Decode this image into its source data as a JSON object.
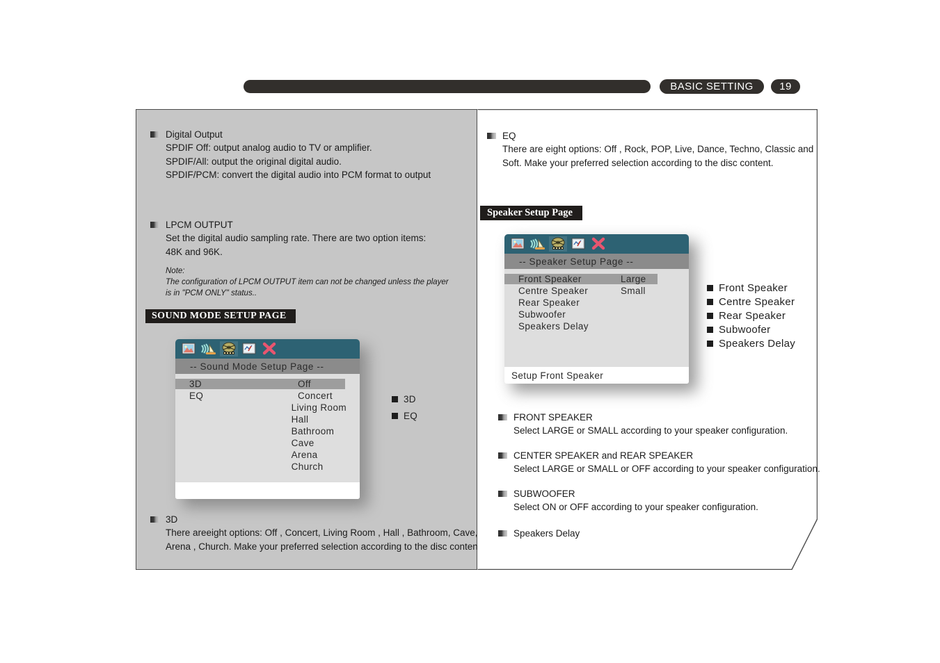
{
  "header": {
    "section_label": "BASIC SETTING",
    "page_number": "19"
  },
  "left_column": {
    "digital_output": {
      "heading": "Digital Output",
      "lines": [
        "SPDIF Off: output analog audio to TV or amplifier.",
        "SPDIF/All: output the original digital audio.",
        "SPDIF/PCM: convert the digital audio into PCM format to output"
      ]
    },
    "lpcm_output": {
      "heading": "LPCM OUTPUT",
      "lines": [
        "Set the digital audio sampling rate. There are two option items:",
        "48K and 96K."
      ],
      "note_label": "Note:",
      "note_lines": [
        "The configuration of LPCM OUTPUT item can not be changed unless the player",
        "is in \"PCM ONLY\" status.."
      ]
    },
    "sound_mode_chip": "SOUND MODE SETUP PAGE",
    "sound_osd": {
      "title": "-- Sound Mode Setup Page --",
      "icons": [
        "picture-icon",
        "speaker-icon",
        "film-reel-icon",
        "preferences-icon",
        "close-x-icon"
      ],
      "selected_icon_index": 2,
      "items": [
        "3D",
        "EQ"
      ],
      "highlighted_item": "3D",
      "options": [
        "Off",
        "Concert",
        "Living Room",
        "Hall",
        "Bathroom",
        "Cave",
        "Arena",
        "Church"
      ],
      "highlighted_option": "Off",
      "footer": ""
    },
    "sound_callout": [
      "3D",
      "EQ"
    ],
    "threed": {
      "heading": "3D",
      "lines": [
        "There areeight options: Off , Concert, Living Room ,  Hall , Bathroom, Cave,",
        "Arena , Church. Make your preferred selection according to the disc content."
      ]
    }
  },
  "right_column": {
    "eq": {
      "heading": "EQ",
      "lines": [
        "There are eight options: Off , Rock, POP, Live, Dance, Techno, Classic and",
        "Soft. Make your preferred selection according to the disc content."
      ]
    },
    "speaker_chip": "Speaker Setup Page",
    "speaker_osd": {
      "title": "-- Speaker Setup Page --",
      "icons": [
        "picture-icon",
        "speaker-icon",
        "film-reel-icon",
        "preferences-icon",
        "close-x-icon"
      ],
      "selected_icon_index": 2,
      "items": [
        "Front Speaker",
        "Centre Speaker",
        "Rear Speaker",
        "Subwoofer",
        "Speakers Delay"
      ],
      "highlighted_item": "Front Speaker",
      "options": [
        "Large",
        "Small"
      ],
      "highlighted_option": "Large",
      "footer": "Setup Front Speaker"
    },
    "speaker_callout": [
      "Front Speaker",
      "Centre Speaker",
      "Rear Speaker",
      "Subwoofer",
      "Speakers Delay"
    ],
    "front_speaker": {
      "heading": "FRONT SPEAKER",
      "lines": [
        "Select LARGE or SMALL according to your speaker configuration."
      ]
    },
    "center_rear_speaker": {
      "heading": "CENTER SPEAKER and REAR SPEAKER",
      "lines": [
        "Select LARGE or SMALL or OFF according to your speaker configuration."
      ]
    },
    "subwoofer": {
      "heading": "SUBWOOFER",
      "lines": [
        "Select ON or OFF according to your speaker configuration."
      ]
    },
    "speakers_delay": {
      "heading": "Speakers Delay",
      "lines": []
    }
  },
  "colors": {
    "page_bg": "#ffffff",
    "left_panel_bg": "#c6c6c6",
    "header_dark": "#322f2c",
    "osd_iconbar": "#2d6273",
    "osd_title_band": "#8b8b8b",
    "osd_body": "#dedede",
    "osd_highlight": "#9d9d9d",
    "close_x": "#e8556f"
  }
}
